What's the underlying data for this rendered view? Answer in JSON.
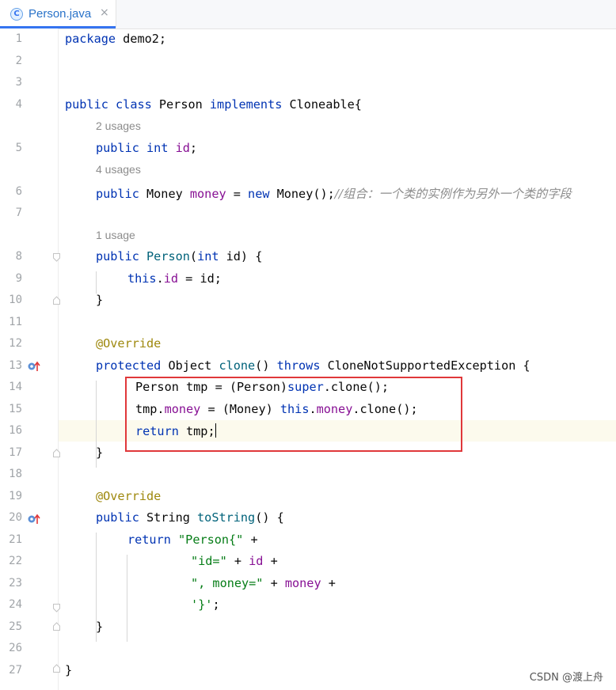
{
  "tab": {
    "title": "Person.java",
    "icon": "C",
    "close": "×"
  },
  "line_numbers": [
    "1",
    "2",
    "3",
    "4",
    "5",
    "6",
    "7",
    "8",
    "9",
    "10",
    "11",
    "12",
    "13",
    "14",
    "15",
    "16",
    "17",
    "18",
    "19",
    "20",
    "21",
    "22",
    "23",
    "24",
    "25",
    "26",
    "27"
  ],
  "hints": {
    "h1": "2 usages",
    "h2": "4 usages",
    "h3": "1 usage"
  },
  "code": {
    "l1": [
      "package",
      " demo2;"
    ],
    "l4": [
      "public",
      " ",
      "class",
      " Person ",
      "implements",
      " Cloneable{"
    ],
    "l5": [
      "public",
      " ",
      "int",
      " ",
      "id",
      ";"
    ],
    "l6": [
      "public",
      " Money ",
      "money",
      " = ",
      "new",
      " Money();",
      "//组合：一个类的实例作为另外一个类的字段"
    ],
    "l8": [
      "public",
      " ",
      "Person",
      "(",
      "int",
      " id) {"
    ],
    "l9": [
      "this",
      ".",
      "id",
      " = id;"
    ],
    "l10": [
      "}"
    ],
    "l12": [
      "@Override"
    ],
    "l13": [
      "protected",
      " Object ",
      "clone",
      "() ",
      "throws",
      " CloneNotSupportedException {"
    ],
    "l14": [
      "Person tmp = (Person)",
      "super",
      ".clone();"
    ],
    "l15": [
      "tmp.",
      "money",
      " = (Money) ",
      "this",
      ".",
      "money",
      ".clone();"
    ],
    "l16": [
      "return",
      " tmp;"
    ],
    "l17": [
      "}"
    ],
    "l19": [
      "@Override"
    ],
    "l20": [
      "public",
      " String ",
      "toString",
      "() {"
    ],
    "l21": [
      "return",
      " ",
      "\"Person{\"",
      " +"
    ],
    "l22": [
      "\"id=\"",
      " + ",
      "id",
      " +"
    ],
    "l23": [
      "\", money=\"",
      " + ",
      "money",
      " +"
    ],
    "l24": [
      "'}'",
      ";"
    ],
    "l25": [
      "}"
    ],
    "l27": [
      "}"
    ]
  },
  "colors": {
    "keyword": "#0033b3",
    "field": "#871094",
    "method": "#00627a",
    "string": "#067d17",
    "annotation": "#9e880d",
    "comment": "#8c8c8c",
    "highlight_box": "#e0383a"
  },
  "watermark": "CSDN @渡上舟"
}
